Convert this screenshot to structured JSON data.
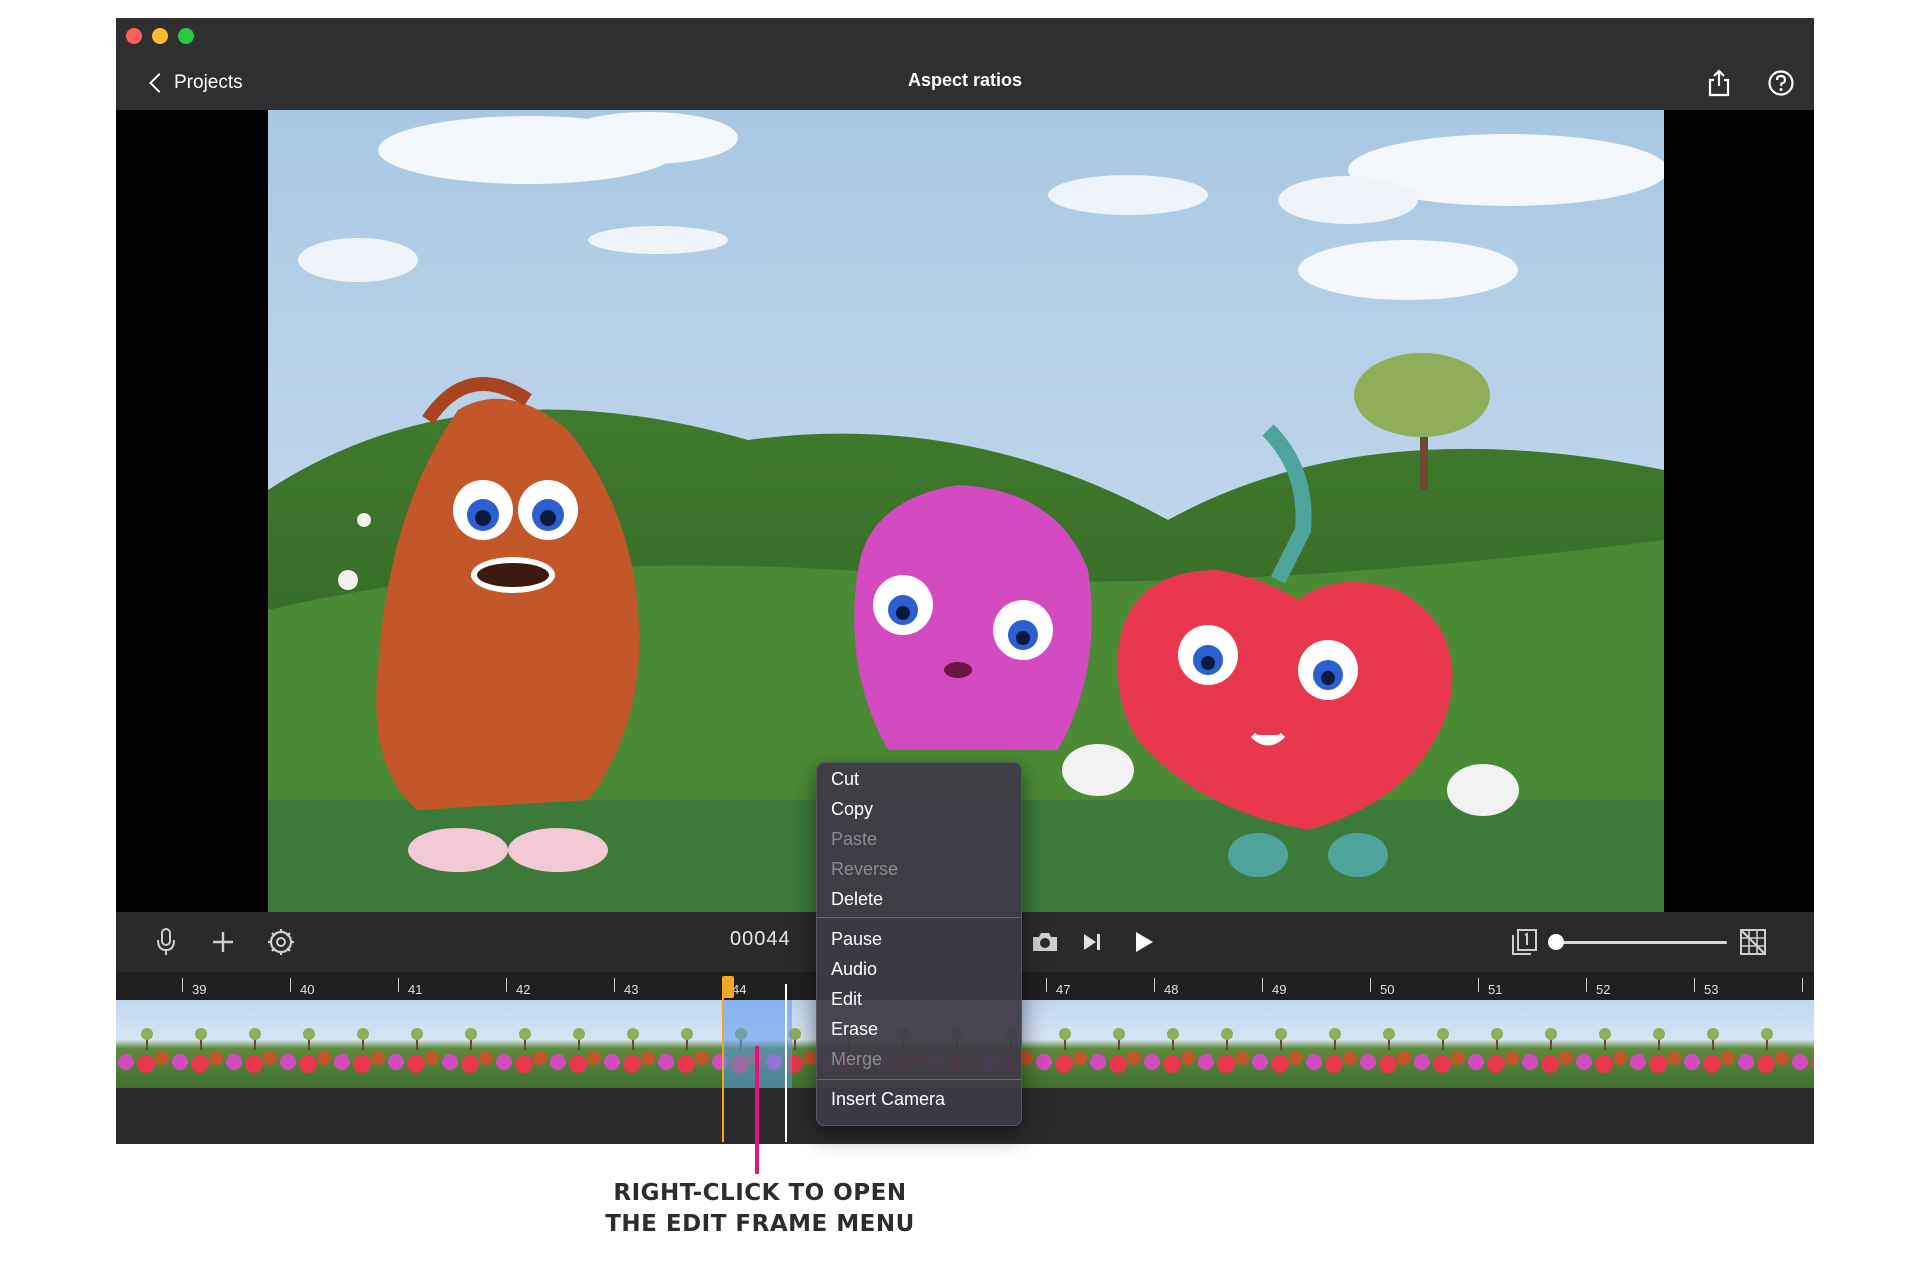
{
  "window": {
    "title": "Aspect ratios",
    "back_label": "Projects"
  },
  "header_icons": [
    "share-icon",
    "help-icon"
  ],
  "controls": {
    "frame_counter": "00044",
    "icons": [
      "microphone-icon",
      "add-icon",
      "settings-icon",
      "camera-icon",
      "step-forward-icon",
      "play-icon",
      "onion-skin-icon",
      "grid-icon"
    ],
    "slider_value": 0.02
  },
  "timeline": {
    "frame_labels": [
      "39",
      "40",
      "41",
      "42",
      "43",
      "44",
      "47",
      "48",
      "49",
      "50",
      "51",
      "52",
      "53"
    ],
    "selected_frame": "44",
    "playhead_color": "#f5a623",
    "selection_color": "#5a96eb"
  },
  "context_menu": {
    "items": [
      {
        "label": "Cut",
        "enabled": true
      },
      {
        "label": "Copy",
        "enabled": true
      },
      {
        "label": "Paste",
        "enabled": false
      },
      {
        "label": "Reverse",
        "enabled": false
      },
      {
        "label": "Delete",
        "enabled": true
      },
      {
        "label": "Pause",
        "enabled": true
      },
      {
        "label": "Audio",
        "enabled": true
      },
      {
        "label": "Edit",
        "enabled": true
      },
      {
        "label": "Erase",
        "enabled": true
      },
      {
        "label": "Merge",
        "enabled": false
      },
      {
        "label": "Insert Camera",
        "enabled": true
      }
    ]
  },
  "annotation": {
    "line1": "RIGHT-CLICK TO OPEN",
    "line2": "THE EDIT FRAME MENU",
    "color": "#e4157a"
  }
}
